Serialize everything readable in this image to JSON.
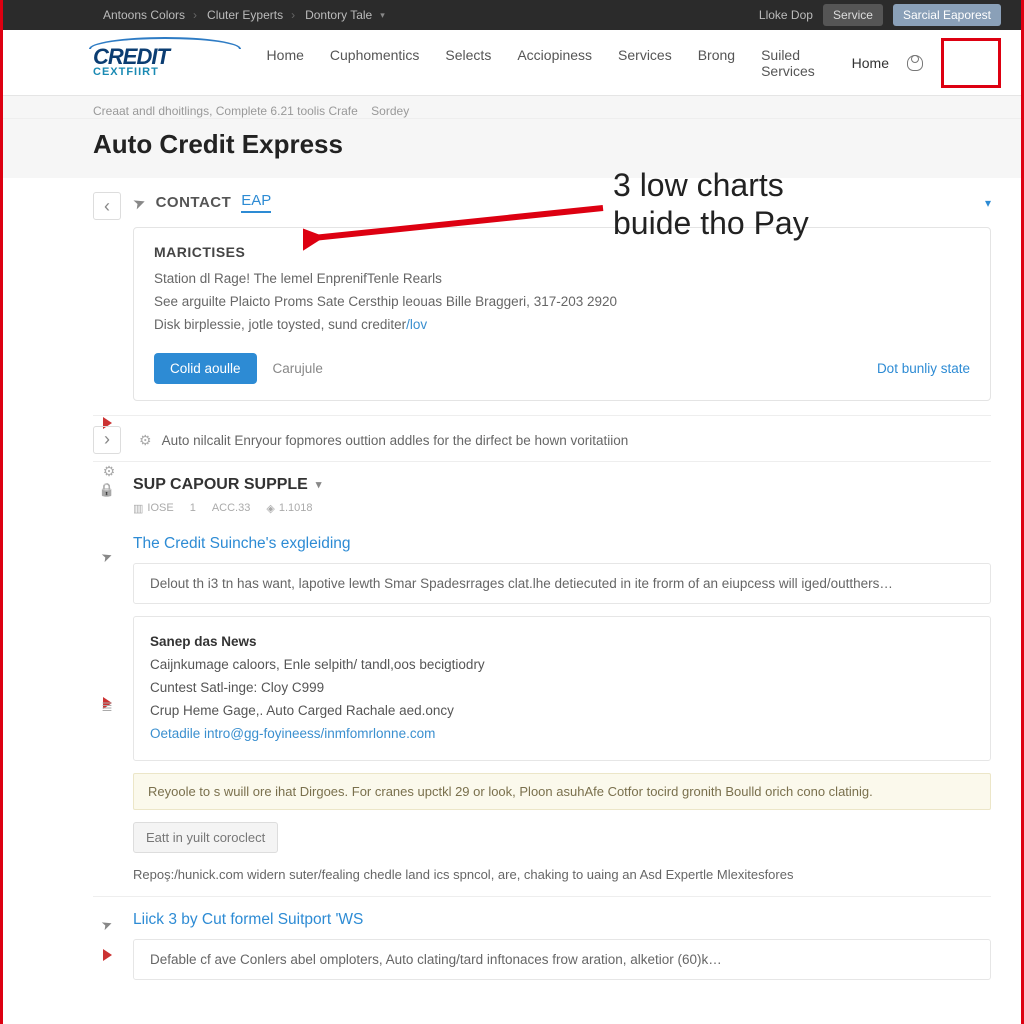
{
  "topbar": {
    "crumbs": [
      "Antoons Colors",
      "Cluter Eyperts",
      "Dontory Tale"
    ],
    "right_link": "Lloke Dop",
    "btn_service": "Service",
    "btn_alt": "Sarcial Eaporest"
  },
  "header": {
    "logo_top": "CREDIT",
    "logo_sub": "CEXTFIIRT",
    "nav": [
      "Home",
      "Cuphomentics",
      "Selects",
      "Acciopiness",
      "Services",
      "Brong",
      "Suiled Services"
    ],
    "home2": "Home"
  },
  "substrip": {
    "crumb": "Creaat andl dhoitlings, Complete 6.21 toolis Crafe",
    "crumb2": "Sordey"
  },
  "page_title": "Auto Credit Express",
  "section1": {
    "contact_label": "CONTACT",
    "contact_link": "EAP",
    "card_title": "MARICTISES",
    "line1": "Station dl Rage! The lemel EnprenifTenle Rearls",
    "line2": "See arguilte Plaicto Proms Sate Cersthip leouas Bille Braggeri, 317-203 2920",
    "line3_a": "Disk birplessie, jotle toysted, sund crediter",
    "line3_b": "/lov",
    "btn_primary": "Colid aoulle",
    "btn_ghost": "Carujule",
    "right_link": "Dot bunliy state"
  },
  "section2": {
    "text": "Auto nilcalit Enryour fopmores outtion addles for the dirfect be hown voritatiion"
  },
  "section3": {
    "title": "SUP CAPOUR SUPPLE",
    "meta": {
      "a": "IOSE",
      "b": "1",
      "c": "ACC.33",
      "d": "1.1018"
    }
  },
  "section4": {
    "title": "The Credit Suinche's exgleiding",
    "quote": "Delout th i3 tn has want, lapotive lewth Smar Spadesrrages clat.lhe detiecuted in ite frorm of an eiupcess will iged/outthers…",
    "news_title": "Sanep das News",
    "news_l1": "Caijnkumage caloors, Enle selpith/ tandl,oos becigtiodry",
    "news_l2": "Cuntest Satl-inge: Cloy C999",
    "news_l3": "Crup Heme Gage,. Auto Carged Rachale aed.oncy",
    "news_mail": "Oetadile intro@gg-foyineess/inmfomrlonne.com",
    "hint": "Reyoole to s wuill ore ihat Dirgoes. For cranes upctkl 29 or look, Ploon asuhAfe Cotfor tocird gronith Boulld orich cono clatinig.",
    "ghost_btn": "Eatt in yuilt coroclect",
    "foot": "Repoş:/hunick.com widern suter/fealing chedle land ics spncol, are, chaking to uaing an Asd Expertle Mlexitesfores"
  },
  "section5": {
    "title": "Liick 3 by Cut formel Suitport 'WS",
    "quote": "Defable cf ave Conlers abel omploters, Auto clating/tard inftonaces frow aration, alketior (60)k…"
  },
  "annotation": {
    "line1": "3 low charts",
    "line2": "buide tho Pay"
  }
}
